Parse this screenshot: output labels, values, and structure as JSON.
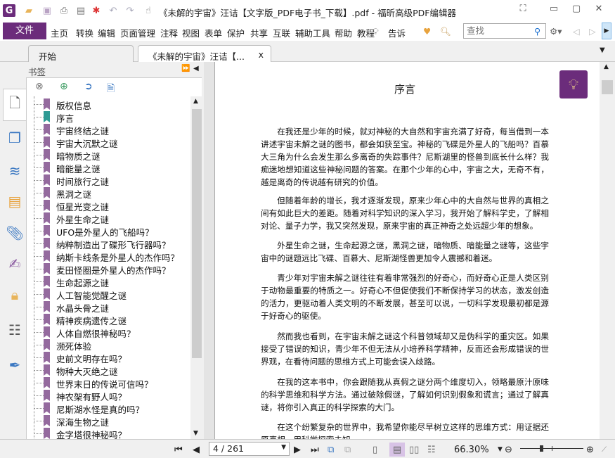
{
  "window": {
    "title": "《未解的宇宙》汪诘【文字版_PDF电子书_下载】.pdf - 福昕高级PDF编辑器"
  },
  "menu": {
    "file": "文件",
    "items": [
      "主页",
      "转换",
      "编辑",
      "页面管理",
      "注释",
      "视图",
      "表单",
      "保护",
      "共享",
      "互联",
      "辅助工具",
      "帮助",
      "教程"
    ],
    "tell": "告诉",
    "search_placeholder": "查找"
  },
  "tabs": [
    {
      "label": "开始"
    },
    {
      "label": "《未解的宇宙》汪诘【...",
      "close": "x"
    }
  ],
  "bookmarks": {
    "title": "书签",
    "items": [
      "版权信息",
      "序言",
      "宇宙终结之谜",
      "宇宙大沉默之谜",
      "暗物质之谜",
      "暗能量之谜",
      "时间旅行之谜",
      "黑洞之谜",
      "恒星光变之谜",
      "外星生命之谜",
      "UFO是外星人的飞船吗？",
      "纳粹制造出了碟形飞行器吗？",
      "纳斯卡线条是外星人的杰作吗？",
      "麦田怪圈是外星人的杰作吗？",
      "生命起源之谜",
      "人工智能觉醒之谜",
      "水晶头骨之谜",
      "精神疾病遗传之谜",
      "人体自燃很神秘吗？",
      "濒死体验",
      "史前文明存在吗？",
      "物种大灭绝之谜",
      "世界末日的传说可信吗？",
      "神农架有野人吗？",
      "尼斯湖水怪是真的吗？",
      "深海生物之谜",
      "金字塔很神秘吗？"
    ],
    "selected_index": 1
  },
  "document": {
    "heading": "序言",
    "paragraphs": [
      "在我还是少年的时候，就对神秘的大自然和宇宙充满了好奇，每当借到一本讲述宇宙未解之谜的图书，都会如获至宝。神秘的飞碟是外星人的飞船吗？百慕大三角为什么会发生那么多离奇的失踪事件？尼斯湖里的怪兽到底长什么样？我痴迷地想知道这些神秘问题的答案。在那个少年的心中，宇宙之大，无奇不有，越是离奇的传说越有研究的价值。",
      "但随着年龄的增长，我才逐渐发现，原来少年心中的大自然与世界的真相之间有如此巨大的差距。随着对科学知识的深入学习，我开始了解科学史，了解相对论、量子力学，我又突然发现，原来宇宙的真正神奇之处远超少年的想象。",
      "外星生命之谜，生命起源之谜，黑洞之谜，暗物质、暗能量之谜等，这些宇宙中的谜题远比飞碟、百慕大、尼斯湖怪兽更加令人震撼和着迷。",
      "青少年对宇宙未解之谜往往有着非常强烈的好奇心，而好奇心正是人类区别于动物最重要的特质之一。好奇心不但促使我们不断保持学习的状态，激发创造的活力，更驱动着人类文明的不断发展，甚至可以说，一切科学发现最初都是源于好奇心的驱使。",
      "然而我也看到，在宇宙未解之谜这个科普领域却又是伪科学的重灾区。如果接受了错误的知识，青少年不但无法从小培养科学精神，反而还会形成错误的世界观，在看待问题的思维方式上可能会误入歧路。",
      "在我的这本书中，你会跟随我从真假之谜分两个维度切入，领略最原汁原味的科学思维和科学方法。通过破除假谜，了解如何识别假象和谎言；通过了解真谜，将你引入真正的科学探索的大门。",
      "在这个纷繁复杂的世界中，我希望你能尽早树立这样的思维方式：用证据还原真相，用科学探索未知。"
    ]
  },
  "status": {
    "page": "4 / 261",
    "zoom": "66.30%",
    "zoom_fraction": 0.33
  },
  "colors": {
    "brand": "#6b2c7b",
    "bookmark": "#946a9e",
    "bookmark_selected": "#2e9a94"
  }
}
